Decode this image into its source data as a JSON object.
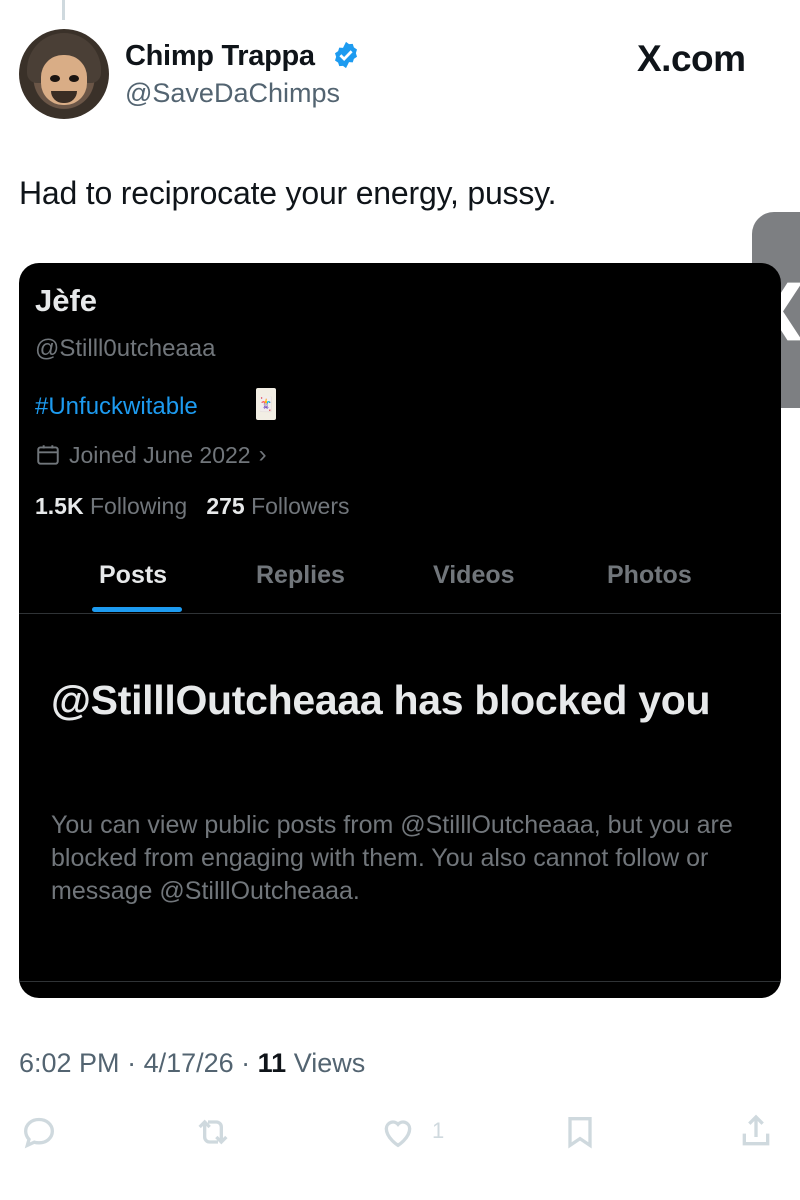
{
  "author": {
    "display_name": "Chimp Trappa",
    "handle": "@SaveDaChimps",
    "verified_icon": "verified-badge-icon"
  },
  "site_logo": "X.com",
  "tweet": {
    "text": "Had to reciprocate your energy, pussy."
  },
  "side_tab": {
    "glyph": "❮"
  },
  "embedded_profile": {
    "name": "Jèfe",
    "handle": "@Stilll0utcheaaa",
    "bio": "#Unfuckwitable",
    "bio_card_glyph": "🃏",
    "joined": "Joined June 2022",
    "following_count": "1.5K",
    "following_label": "Following",
    "followers_count": "275",
    "followers_label": "Followers",
    "tabs": [
      "Posts",
      "Replies",
      "Videos",
      "Photos"
    ],
    "blocked_title": "@StilllOutcheaaa has blocked you",
    "blocked_desc": "You can view public posts from @StilllOutcheaaa, but you are blocked from engaging with them. You also cannot follow or message @StilllOutcheaaa.",
    "accent_color": "#1d9bf0"
  },
  "meta": {
    "time": "6:02 PM",
    "sep1": " · ",
    "date": "4/17/26",
    "sep2": " · ",
    "views_count": "11",
    "views_label": "Views"
  },
  "actions": {
    "like_count": "1",
    "icons": [
      "reply-icon",
      "repost-icon",
      "like-icon",
      "bookmark-icon",
      "share-icon"
    ]
  }
}
